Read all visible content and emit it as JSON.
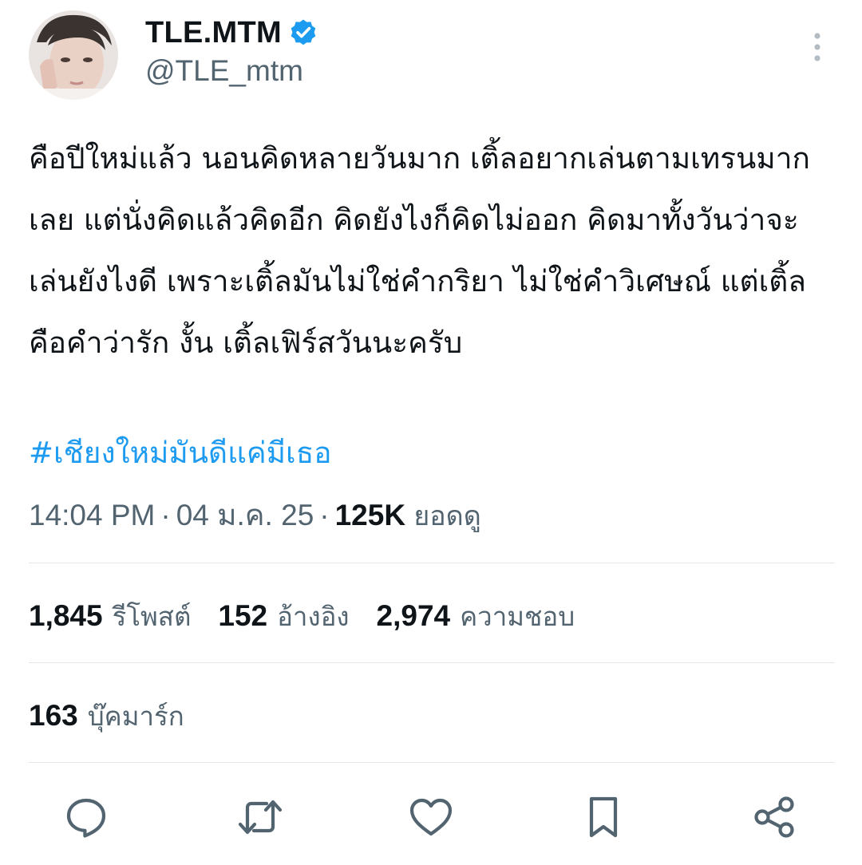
{
  "user": {
    "display_name": "TLE.MTM",
    "handle": "@TLE_mtm",
    "verified": true
  },
  "tweet": {
    "text": "คือปีใหม่แล้ว นอนคิดหลายวันมาก เติ้ลอยากเล่นตามเทรนมากเลย แต่นั่งคิดแล้วคิดอีก คิดยังไงก็คิดไม่ออก คิดมาทั้งวันว่าจะเล่นยังไงดี เพราะเติ้ลมันไม่ใช่คำกริยา ไม่ใช่คำวิเศษณ์ แต่เติ้ลคือคำว่ารัก งั้น เติ้ลเฟิร์สวันนะครับ",
    "hashtag": "#เชียงใหม่มันดีแค่มีเธอ",
    "time": "14:04 PM",
    "date": "04 ม.ค. 25",
    "views_count": "125K",
    "views_label": "ยอดดู"
  },
  "stats": {
    "reposts_count": "1,845",
    "reposts_label": "รีโพสต์",
    "quotes_count": "152",
    "quotes_label": "อ้างอิง",
    "likes_count": "2,974",
    "likes_label": "ความชอบ",
    "bookmarks_count": "163",
    "bookmarks_label": "บุ๊คมาร์ก"
  },
  "icons": {
    "verified": "verified-badge-icon",
    "more": "more-vertical-icon",
    "reply": "reply-icon",
    "repost": "repost-icon",
    "like": "like-icon",
    "bookmark": "bookmark-icon",
    "share": "share-icon"
  },
  "colors": {
    "accent": "#1d9bf0",
    "text_primary": "#0f1419",
    "text_secondary": "#536471",
    "divider": "#e3e7ea"
  }
}
